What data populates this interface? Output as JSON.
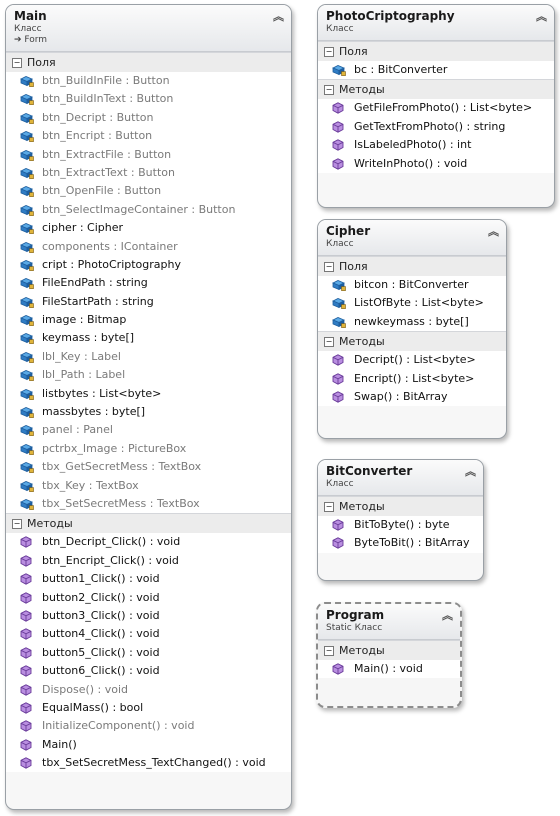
{
  "labels": {
    "fields": "Поля",
    "methods": "Методы"
  },
  "icons": {
    "field": "field-icon",
    "method": "method-icon",
    "collapse": "chevron-up-icon",
    "inherit": "inheritance-arrow-icon"
  },
  "main": {
    "title": "Main",
    "stereotype": "Класс",
    "base": "Form",
    "fields": [
      {
        "text": "btn_BuildInFile : Button",
        "muted": true
      },
      {
        "text": "btn_BuildInText : Button",
        "muted": true
      },
      {
        "text": "btn_Decript : Button",
        "muted": true
      },
      {
        "text": "btn_Encript : Button",
        "muted": true
      },
      {
        "text": "btn_ExtractFile : Button",
        "muted": true
      },
      {
        "text": "btn_ExtractText : Button",
        "muted": true
      },
      {
        "text": "btn_OpenFile : Button",
        "muted": true
      },
      {
        "text": "btn_SelectImageContainer : Button",
        "muted": true
      },
      {
        "text": "cipher : Cipher",
        "muted": false
      },
      {
        "text": "components : IContainer",
        "muted": true
      },
      {
        "text": "cript : PhotoCriptography",
        "muted": false
      },
      {
        "text": "FileEndPath : string",
        "muted": false
      },
      {
        "text": "FileStartPath : string",
        "muted": false
      },
      {
        "text": "image : Bitmap",
        "muted": false
      },
      {
        "text": "keymass : byte[]",
        "muted": false
      },
      {
        "text": "lbl_Key : Label",
        "muted": true
      },
      {
        "text": "lbl_Path : Label",
        "muted": true
      },
      {
        "text": "listbytes : List<byte>",
        "muted": false
      },
      {
        "text": "massbytes : byte[]",
        "muted": false
      },
      {
        "text": "panel : Panel",
        "muted": true
      },
      {
        "text": "pctrbx_Image : PictureBox",
        "muted": true
      },
      {
        "text": "tbx_GetSecretMess : TextBox",
        "muted": true
      },
      {
        "text": "tbx_Key : TextBox",
        "muted": true
      },
      {
        "text": "tbx_SetSecretMess : TextBox",
        "muted": true
      }
    ],
    "methods": [
      {
        "text": "btn_Decript_Click() : void",
        "muted": false
      },
      {
        "text": "btn_Encript_Click() : void",
        "muted": false
      },
      {
        "text": "button1_Click() : void",
        "muted": false
      },
      {
        "text": "button2_Click() : void",
        "muted": false
      },
      {
        "text": "button3_Click() : void",
        "muted": false
      },
      {
        "text": "button4_Click() : void",
        "muted": false
      },
      {
        "text": "button5_Click() : void",
        "muted": false
      },
      {
        "text": "button6_Click() : void",
        "muted": false
      },
      {
        "text": "Dispose() : void",
        "muted": true
      },
      {
        "text": "EqualMass() : bool",
        "muted": false
      },
      {
        "text": "InitializeComponent() : void",
        "muted": true
      },
      {
        "text": "Main()",
        "muted": false
      },
      {
        "text": "tbx_SetSecretMess_TextChanged() : void",
        "muted": false
      }
    ]
  },
  "photo": {
    "title": "PhotoCriptography",
    "stereotype": "Класс",
    "fields": [
      {
        "text": "bc : BitConverter",
        "muted": false
      }
    ],
    "methods": [
      {
        "text": "GetFileFromPhoto() : List<byte>",
        "muted": false
      },
      {
        "text": "GetTextFromPhoto() : string",
        "muted": false
      },
      {
        "text": "IsLabeledPhoto() : int",
        "muted": false
      },
      {
        "text": "WriteInPhoto() : void",
        "muted": false
      }
    ]
  },
  "cipher": {
    "title": "Cipher",
    "stereotype": "Класс",
    "fields": [
      {
        "text": "bitcon : BitConverter",
        "muted": false
      },
      {
        "text": "ListOfByte : List<byte>",
        "muted": false
      },
      {
        "text": "newkeymass : byte[]",
        "muted": false
      }
    ],
    "methods": [
      {
        "text": "Decript() : List<byte>",
        "muted": false
      },
      {
        "text": "Encript() : List<byte>",
        "muted": false
      },
      {
        "text": "Swap() : BitArray",
        "muted": false
      }
    ]
  },
  "bitconverter": {
    "title": "BitConverter",
    "stereotype": "Класс",
    "methods": [
      {
        "text": "BitToByte() : byte",
        "muted": false
      },
      {
        "text": "ByteToBit() : BitArray",
        "muted": false
      }
    ]
  },
  "program": {
    "title": "Program",
    "stereotype": "Static Класс",
    "methods": [
      {
        "text": "Main() : void",
        "muted": false
      }
    ]
  }
}
